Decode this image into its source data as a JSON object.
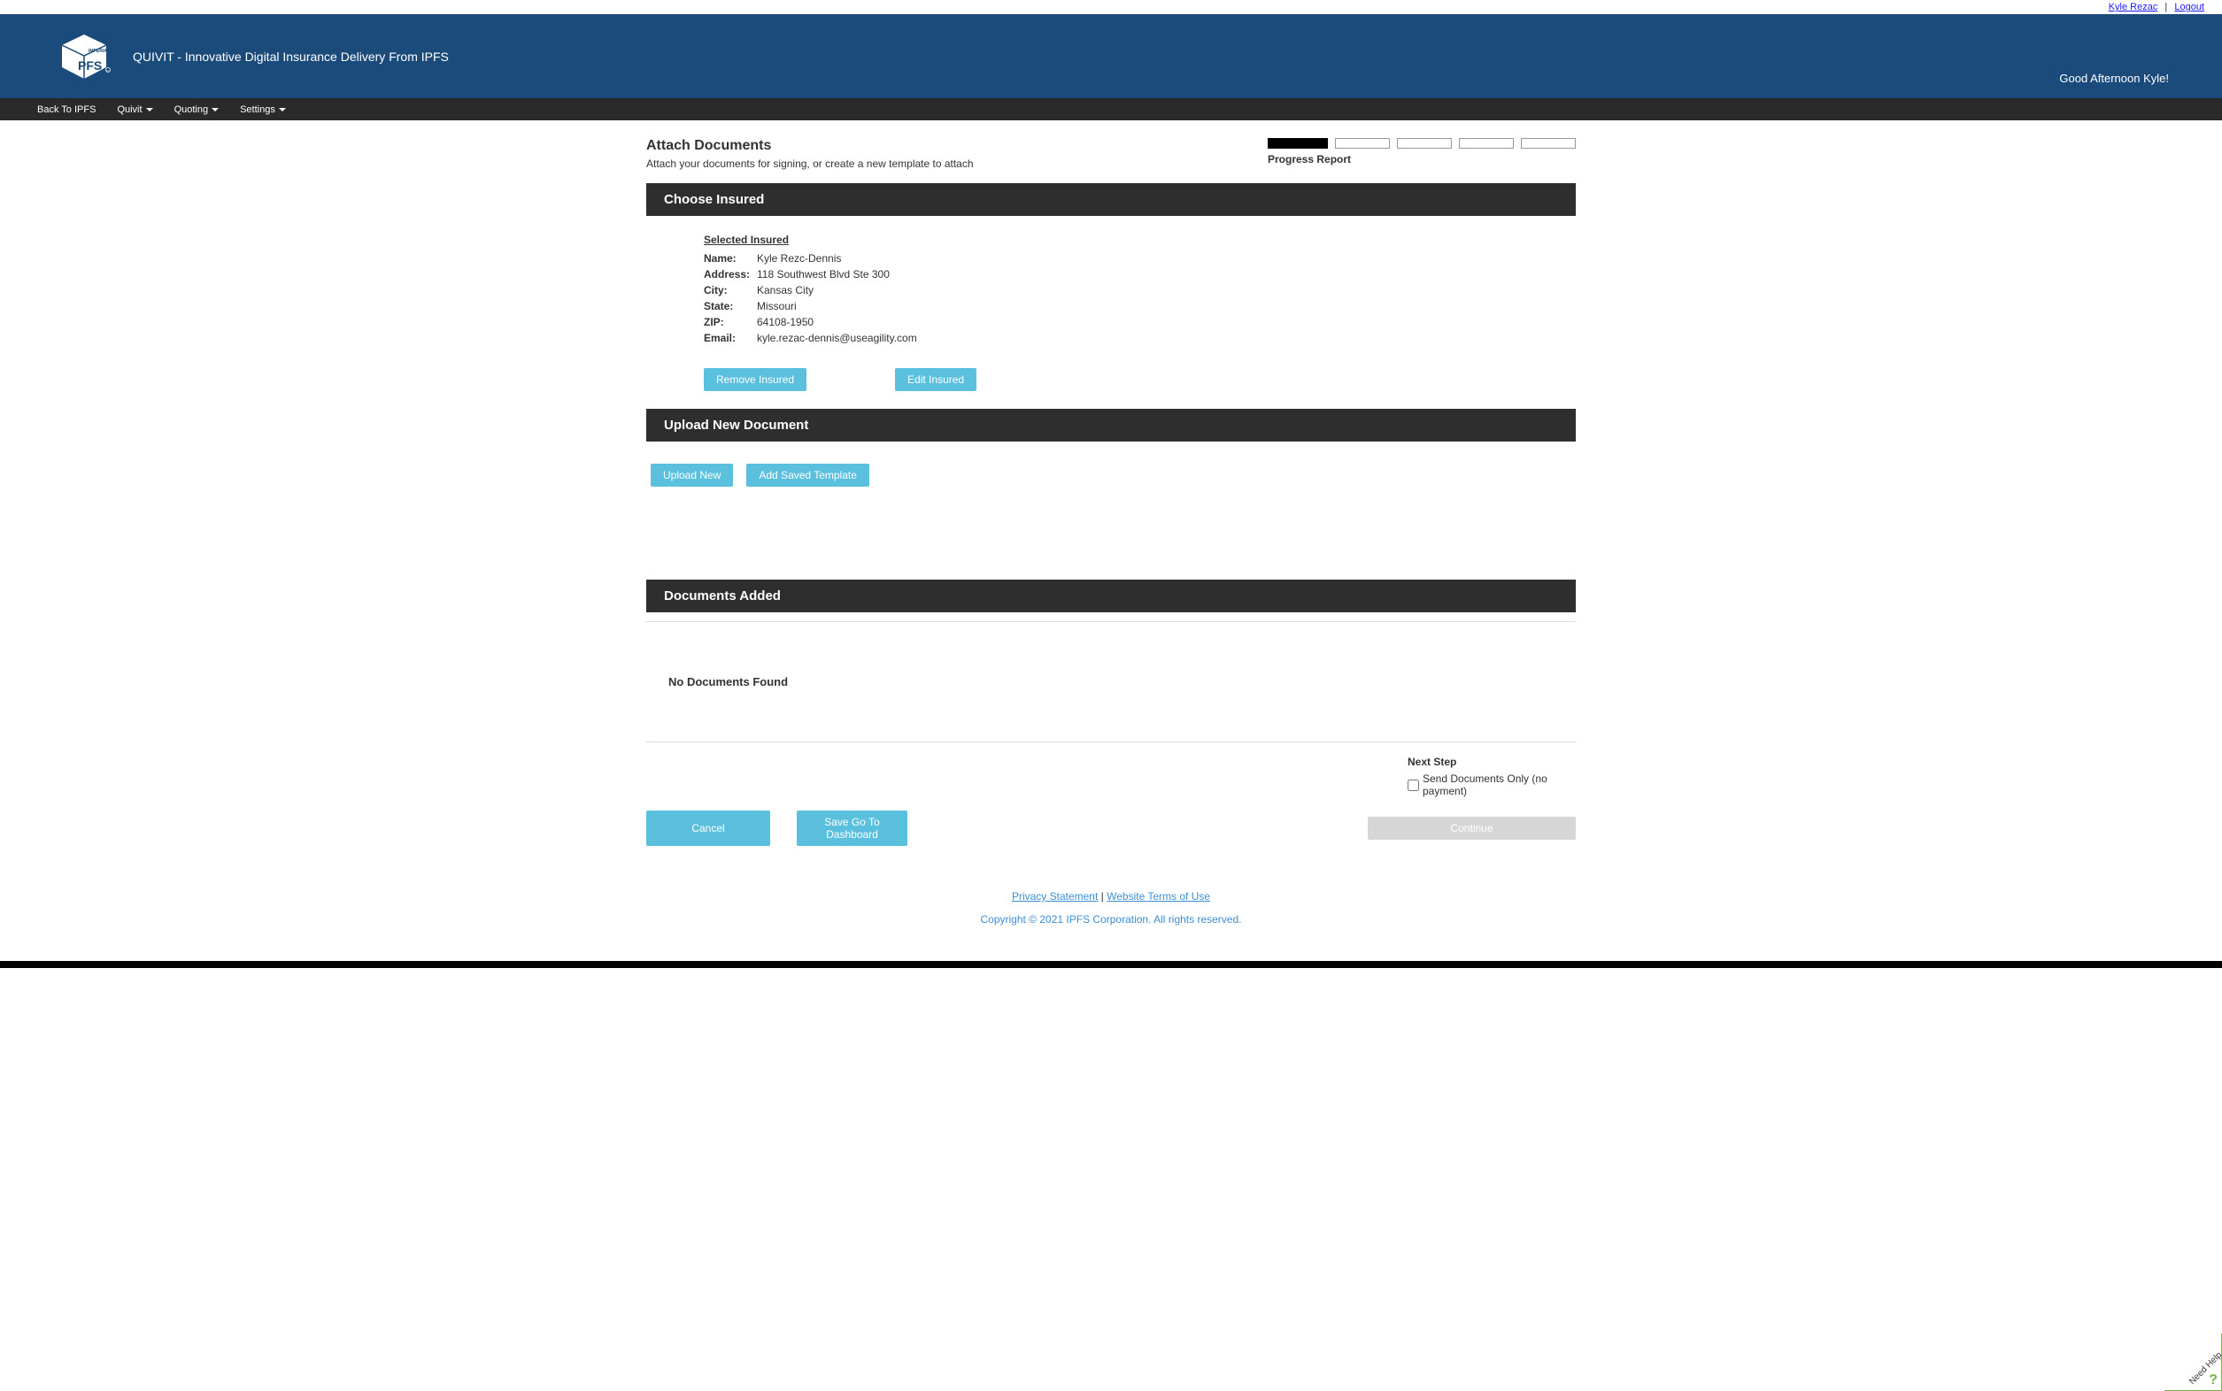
{
  "top_bar": {
    "username": "Kyle Rezac",
    "separator": "|",
    "logout": "Logout"
  },
  "header": {
    "title": "QUIVIT - Innovative Digital Insurance Delivery From IPFS",
    "greeting": "Good Afternoon Kyle!"
  },
  "navbar": {
    "back": "Back To IPFS",
    "quivit": "Quivit",
    "quoting": "Quoting",
    "settings": "Settings"
  },
  "page": {
    "title": "Attach Documents",
    "subtitle": "Attach your documents for signing, or create a new template to attach",
    "progress_label": "Progress Report"
  },
  "sections": {
    "choose_insured": "Choose Insured",
    "upload_new": "Upload New Document",
    "documents_added": "Documents Added"
  },
  "insured": {
    "heading": "Selected Insured",
    "labels": {
      "name": "Name:",
      "address": "Address:",
      "city": "City:",
      "state": "State:",
      "zip": "ZIP:",
      "email": "Email:"
    },
    "values": {
      "name": "Kyle Rezc-Dennis",
      "address": "118 Southwest Blvd Ste 300",
      "city": "Kansas City",
      "state": "Missouri",
      "zip": "64108-1950",
      "email": "kyle.rezac-dennis@useagility.com"
    }
  },
  "buttons": {
    "remove_insured": "Remove Insured",
    "edit_insured": "Edit Insured",
    "upload_new": "Upload New",
    "add_saved_template": "Add Saved Template",
    "cancel": "Cancel",
    "save_dashboard": "Save Go To Dashboard",
    "continue": "Continue"
  },
  "documents": {
    "empty": "No Documents Found"
  },
  "next_step": {
    "title": "Next Step",
    "checkbox_label": "Send Documents Only (no payment)"
  },
  "footer": {
    "privacy": "Privacy Statement",
    "separator": " | ",
    "terms": "Website Terms of Use",
    "copyright": "Copyright © 2021 IPFS Corporation. All rights reserved."
  },
  "help": {
    "text": "Need Help",
    "icon": "?"
  }
}
